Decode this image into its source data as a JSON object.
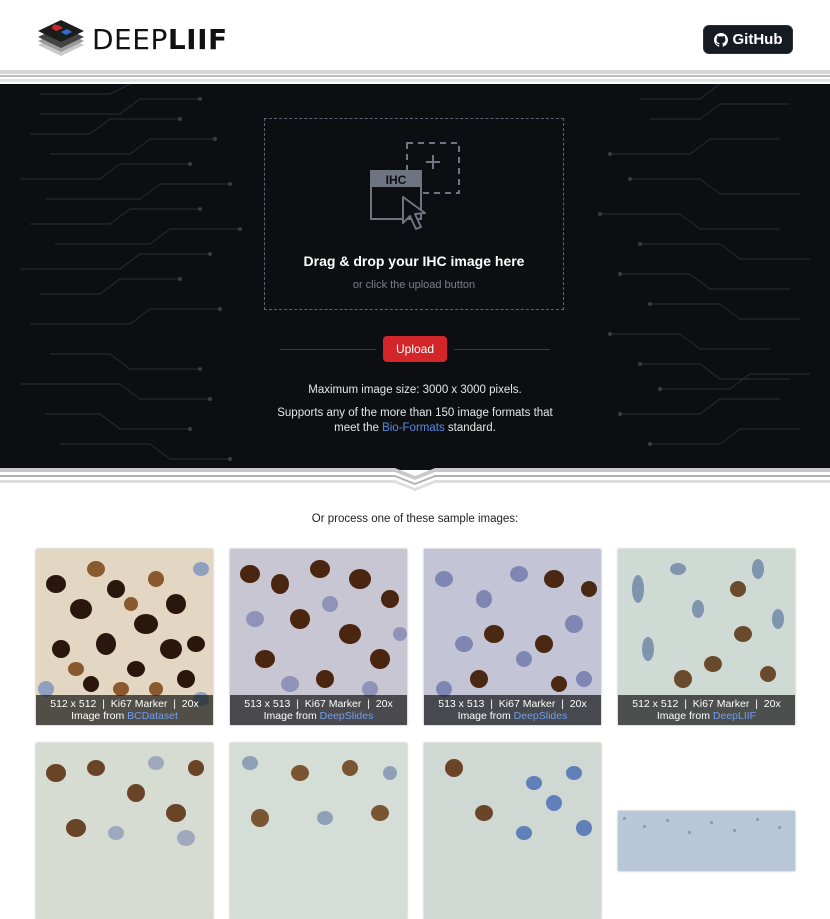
{
  "header": {
    "logo_text_light": "DEEP",
    "logo_text_bold": "LIIF",
    "github_label": "GitHub"
  },
  "dropzone": {
    "icon_label": "IHC",
    "title": "Drag & drop your IHC image here",
    "subtitle": "or click the upload button"
  },
  "upload": {
    "label": "Upload"
  },
  "info": {
    "max_size": "Maximum image size: 3000 x 3000 pixels.",
    "formats_prefix": "Supports any of the more than 150 image formats that meet the",
    "formats_link": "Bio-Formats",
    "formats_suffix": "standard."
  },
  "samples": {
    "title": "Or process one of these sample images:",
    "items": [
      {
        "size": "512 x 512",
        "marker": "Ki67 Marker",
        "zoom": "20x",
        "source_prefix": "Image from",
        "source": "BCDataset"
      },
      {
        "size": "513 x 513",
        "marker": "Ki67 Marker",
        "zoom": "20x",
        "source_prefix": "Image from",
        "source": "DeepSlides"
      },
      {
        "size": "513 x 513",
        "marker": "Ki67 Marker",
        "zoom": "20x",
        "source_prefix": "Image from",
        "source": "DeepSlides"
      },
      {
        "size": "512 x 512",
        "marker": "Ki67 Marker",
        "zoom": "20x",
        "source_prefix": "Image from",
        "source": "DeepLIIF"
      }
    ]
  },
  "colors": {
    "hero_bg": "#0d0e12",
    "upload_red": "#d3262b",
    "link_blue": "#5b8dde",
    "github_bg": "#161b22"
  }
}
